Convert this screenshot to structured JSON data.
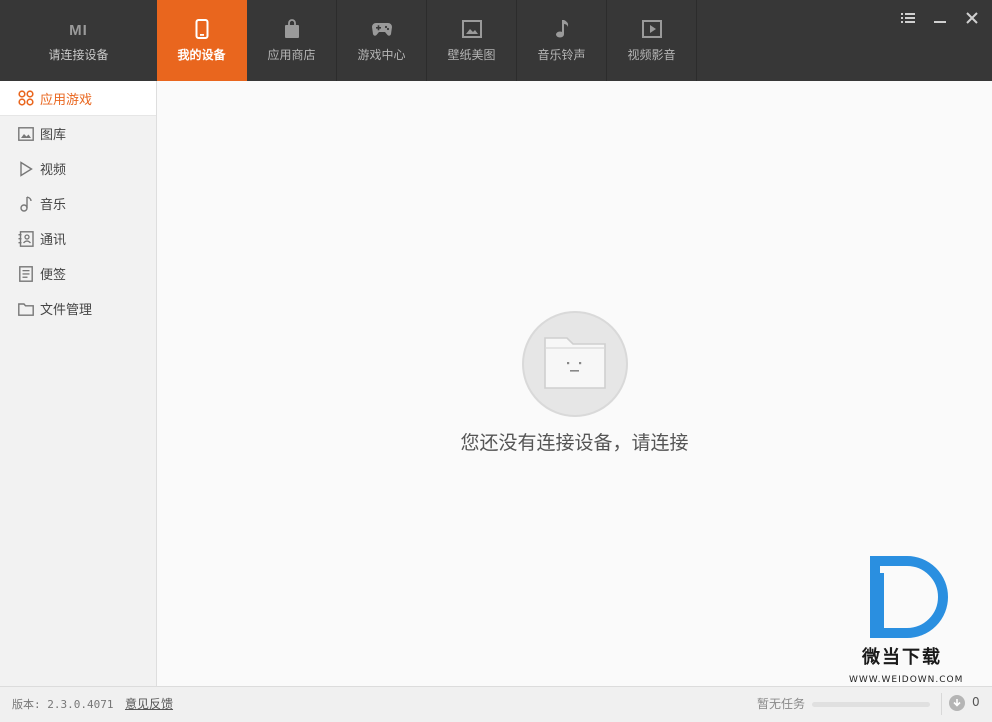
{
  "device": {
    "logo": "MI",
    "label": "请连接设备"
  },
  "tabs": [
    {
      "label": "我的设备",
      "icon": "phone-icon",
      "active": true
    },
    {
      "label": "应用商店",
      "icon": "shopping-bag-icon",
      "active": false
    },
    {
      "label": "游戏中心",
      "icon": "gamepad-icon",
      "active": false
    },
    {
      "label": "壁纸美图",
      "icon": "picture-icon",
      "active": false
    },
    {
      "label": "音乐铃声",
      "icon": "music-note-icon",
      "active": false
    },
    {
      "label": "视频影音",
      "icon": "video-play-icon",
      "active": false
    }
  ],
  "window_controls": [
    "menu-icon",
    "minimize-icon",
    "close-icon"
  ],
  "sidebar": {
    "items": [
      {
        "label": "应用游戏",
        "icon": "apps-grid-icon",
        "active": true
      },
      {
        "label": "图库",
        "icon": "image-icon",
        "active": false
      },
      {
        "label": "视频",
        "icon": "play-triangle-icon",
        "active": false
      },
      {
        "label": "音乐",
        "icon": "music-note-icon",
        "active": false
      },
      {
        "label": "通讯",
        "icon": "contacts-icon",
        "active": false
      },
      {
        "label": "便签",
        "icon": "note-icon",
        "active": false
      },
      {
        "label": "文件管理",
        "icon": "folder-icon",
        "active": false
      }
    ]
  },
  "main": {
    "empty_message": "您还没有连接设备，请连接"
  },
  "watermark": {
    "brand": "微当下载",
    "url": "WWW.WEIDOWN.COM"
  },
  "status": {
    "version": "版本: 2.3.0.4071",
    "feedback": "意见反馈",
    "task": "暂无任务",
    "download_count": "0"
  },
  "colors": {
    "accent": "#e9661e",
    "topbar": "#373737",
    "watermark_blue": "#2a8fe0"
  }
}
